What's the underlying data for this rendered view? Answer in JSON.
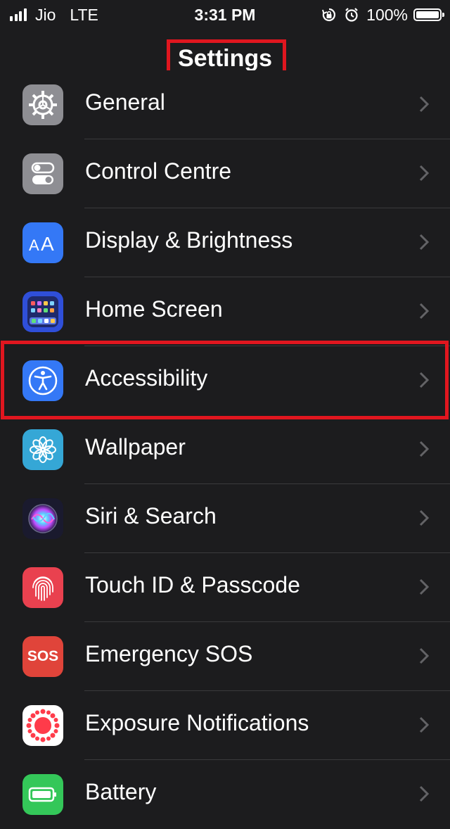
{
  "status_bar": {
    "carrier": "Jio",
    "network": "LTE",
    "time": "3:31 PM",
    "battery": "100%"
  },
  "nav": {
    "title": "Settings"
  },
  "settings": [
    {
      "label": "General",
      "icon": "gear-icon",
      "color": "#8e8e93"
    },
    {
      "label": "Control Centre",
      "icon": "toggles-icon",
      "color": "#8e8e93"
    },
    {
      "label": "Display & Brightness",
      "icon": "text-size-icon",
      "color": "#3478f6"
    },
    {
      "label": "Home Screen",
      "icon": "app-grid-icon",
      "color": "#2f4fd9"
    },
    {
      "label": "Accessibility",
      "icon": "accessibility-icon",
      "color": "#3478f6"
    },
    {
      "label": "Wallpaper",
      "icon": "flower-icon",
      "color": "#35a7d6"
    },
    {
      "label": "Siri & Search",
      "icon": "siri-icon",
      "color": "#1a1a2e"
    },
    {
      "label": "Touch ID & Passcode",
      "icon": "fingerprint-icon",
      "color": "#e9414f"
    },
    {
      "label": "Emergency SOS",
      "icon": "sos-icon",
      "color": "#e0443a",
      "icon_text": "SOS"
    },
    {
      "label": "Exposure Notifications",
      "icon": "exposure-icon",
      "color": "#ffffff"
    },
    {
      "label": "Battery",
      "icon": "battery-icon",
      "color": "#34c759"
    }
  ],
  "highlight_color": "#e0161f"
}
